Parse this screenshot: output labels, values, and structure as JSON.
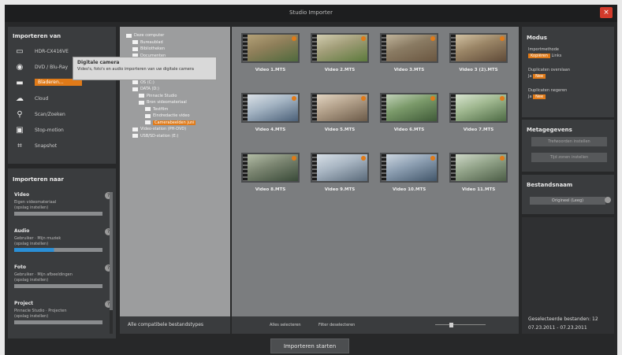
{
  "window": {
    "title": "Studio Importer",
    "close_glyph": "×"
  },
  "source": {
    "title": "Importeren van",
    "items": [
      {
        "label": "HDR-CX416VE",
        "icon": "camcorder-icon"
      },
      {
        "label": "DVD / Blu-Ray",
        "icon": "disc-icon"
      },
      {
        "label": "Bladeren…",
        "icon": "folder-icon",
        "selected": true
      },
      {
        "label": "Cloud",
        "icon": "cloud-icon"
      },
      {
        "label": "Scan/Zoeken",
        "icon": "search-icon"
      },
      {
        "label": "Stop-motion",
        "icon": "stopmotion-icon"
      },
      {
        "label": "Snapshot",
        "icon": "snapshot-icon"
      }
    ]
  },
  "tooltip": {
    "title": "Digitale camera",
    "text": "Video's, foto's en audio importeren van uw digitale camera"
  },
  "destination": {
    "title": "Importeren naar",
    "sections": [
      {
        "title": "Video",
        "line1": "Eigen videomateriaal",
        "line2": "(opslag instellen)"
      },
      {
        "title": "Audio",
        "line1": "Gebruiker · Mijn muziek",
        "line2": "(opslag instellen)"
      },
      {
        "title": "Foto",
        "line1": "Gebruiker · Mijn afbeeldingen",
        "line2": "(opslag instellen)"
      },
      {
        "title": "Project",
        "line1": "Pinnacle Studio · Projecten",
        "line2": "(opslag instellen)"
      }
    ]
  },
  "tree": {
    "items": [
      {
        "label": "Deze computer",
        "indent": 0
      },
      {
        "label": "Bureaublad",
        "indent": 1
      },
      {
        "label": "Bibliotheken",
        "indent": 1
      },
      {
        "label": "Documenten",
        "indent": 1
      },
      {
        "label": "Muziek",
        "indent": 1
      },
      {
        "label": "Afbeeldingen",
        "indent": 1
      },
      {
        "label": "Video's",
        "indent": 1
      },
      {
        "label": "OS (C:)",
        "indent": 1
      },
      {
        "label": "DATA (D:)",
        "indent": 1
      },
      {
        "label": "Pinnacle Studio",
        "indent": 2
      },
      {
        "label": "Bron videomateriaal",
        "indent": 2
      },
      {
        "label": "Testfilm",
        "indent": 3
      },
      {
        "label": "Eindredactie video",
        "indent": 3
      },
      {
        "label": "Camerabeelden juni",
        "indent": 3,
        "selected": true
      },
      {
        "label": "Video-station (PH-DVD)",
        "indent": 1
      },
      {
        "label": "USB/SD-station (E:)",
        "indent": 1
      }
    ],
    "bottom_label": "Alle compatibele bestandstypes"
  },
  "thumbnails": [
    {
      "name": "Video 1.MTS",
      "colors": [
        "#4f6a3d",
        "#8f7f5a",
        "#b7a47a"
      ]
    },
    {
      "name": "Video 2.MTS",
      "colors": [
        "#5c7a3c",
        "#a19d78",
        "#d6d1b5"
      ]
    },
    {
      "name": "Video 3.MTS",
      "colors": [
        "#6a5640",
        "#8a7b63",
        "#c5b9a0"
      ]
    },
    {
      "name": "Video 3 (2).MTS",
      "colors": [
        "#5f4a38",
        "#9a8566",
        "#d7c7a8"
      ]
    },
    {
      "name": "Video 4.MTS",
      "colors": [
        "#4b6078",
        "#a3b3c2",
        "#e0e5ea"
      ]
    },
    {
      "name": "Video 5.MTS",
      "colors": [
        "#6b5a48",
        "#b2a08a",
        "#e6d9c6"
      ]
    },
    {
      "name": "Video 6.MTS",
      "colors": [
        "#3f5a38",
        "#7b9a6a",
        "#c8d7c0"
      ]
    },
    {
      "name": "Video 7.MTS",
      "colors": [
        "#4d6a44",
        "#9fb78f",
        "#dde8d6"
      ]
    },
    {
      "name": "Video 8.MTS",
      "colors": [
        "#394a38",
        "#7b8571",
        "#b8c2ab"
      ]
    },
    {
      "name": "Video 9.MTS",
      "colors": [
        "#5a6a7a",
        "#a8b5c2",
        "#dbe3ea"
      ]
    },
    {
      "name": "Video 10.MTS",
      "colors": [
        "#42566a",
        "#8d9fb2",
        "#d2dbe4"
      ]
    },
    {
      "name": "Video 11.MTS",
      "colors": [
        "#4c5d46",
        "#93a48a",
        "#d3dccd"
      ]
    }
  ],
  "gridbar": {
    "select_all": "Alles selecteren",
    "filter": "Filter deselecteren"
  },
  "modus": {
    "title": "Modus",
    "line1": "Importmethode",
    "pill1": "Kopiëren",
    "tail1": "Links",
    "line2": "Duplicaten overslaan",
    "pill2": "Ja",
    "tail2": "Nee",
    "line3": "Duplicaten negeren",
    "pill3": "Ja",
    "tail3": "Nee"
  },
  "metadata": {
    "title": "Metagegevens",
    "btn1": "Trefwoorden instellen",
    "btn2": "Tijd zonen instellen"
  },
  "filename": {
    "title": "Bestandsnaam",
    "value": "Origineel (Leeg)"
  },
  "selection": {
    "count_line": "Geselecteerde bestanden: 12",
    "date_line": "07.23.2011 - 07.23.2011"
  },
  "start_label": "Importeren starten"
}
